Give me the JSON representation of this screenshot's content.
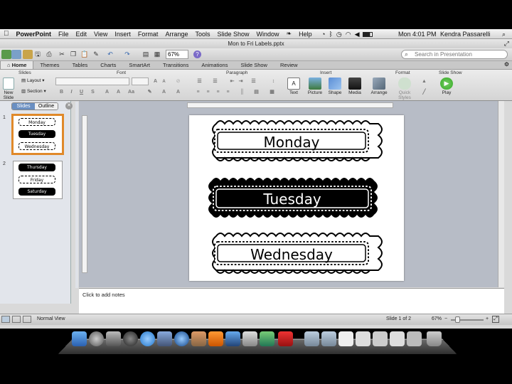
{
  "menubar": {
    "apple": "",
    "items": [
      "PowerPoint",
      "File",
      "Edit",
      "View",
      "Insert",
      "Format",
      "Arrange",
      "Tools",
      "Slide Show",
      "Window",
      "Help"
    ],
    "clock": "Mon 4:01 PM",
    "user": "Kendra Passarelli"
  },
  "window": {
    "title": "Mon to Fri Labels.pptx"
  },
  "toolbar": {
    "zoom": "67%",
    "search_placeholder": "Search in Presentation"
  },
  "ribbon_tabs": [
    "Home",
    "Themes",
    "Tables",
    "Charts",
    "SmartArt",
    "Transitions",
    "Animations",
    "Slide Show",
    "Review"
  ],
  "ribbon": {
    "groups": {
      "slides": "Slides",
      "font": "Font",
      "paragraph": "Paragraph",
      "insert": "Insert",
      "format": "Format",
      "slideshow": "Slide Show"
    },
    "new_slide": "New Slide",
    "layout": "Layout",
    "section": "Section",
    "insert_buttons": [
      "Text",
      "Picture",
      "Shape",
      "Media"
    ],
    "format_buttons": [
      "Arrange",
      "Quick Styles"
    ],
    "play": "Play"
  },
  "panel": {
    "tabs": [
      "Slides",
      "Outline"
    ],
    "thumb1_labels": [
      "Monday",
      "Tuesday",
      "Wednesday"
    ],
    "thumb2_labels": [
      "Thursday",
      "Friday",
      "Saturday"
    ]
  },
  "slide": {
    "labels": [
      "Monday",
      "Tuesday",
      "Wednesday"
    ]
  },
  "notes": {
    "placeholder": "Click to add notes"
  },
  "status": {
    "view": "Normal View",
    "slide": "Slide 1 of 2",
    "zoom": "67%"
  },
  "colors": {
    "selection": "#e0892a",
    "ribbon_bg": "#e0e0e0",
    "editor_bg": "#b7bcc6"
  }
}
